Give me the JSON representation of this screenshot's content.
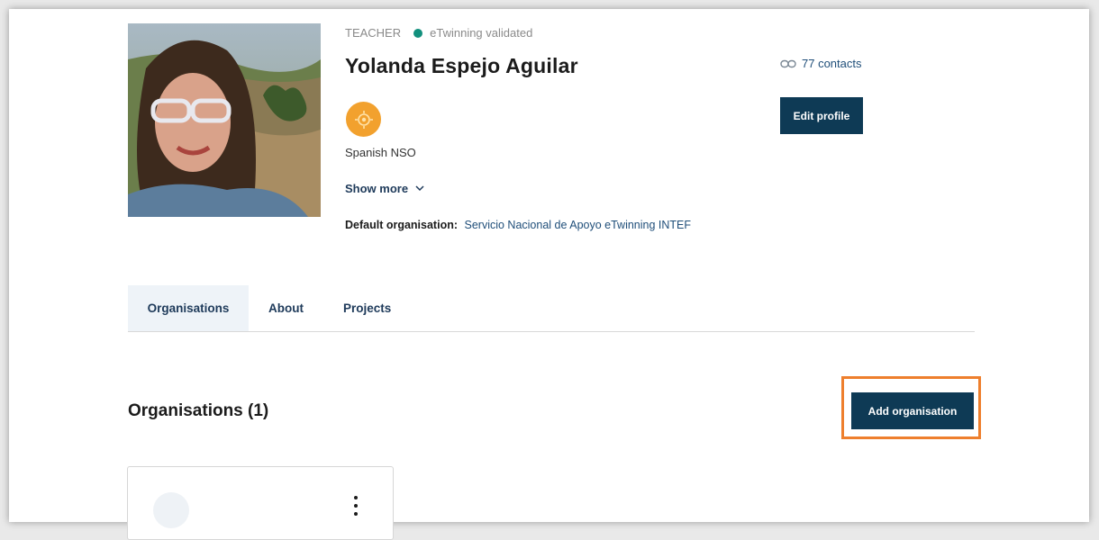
{
  "profile": {
    "role": "TEACHER",
    "validation": "eTwinning validated",
    "name": "Yolanda Espejo Aguilar",
    "affiliation": "Spanish NSO",
    "show_more": "Show more",
    "default_org_label": "Default organisation:",
    "default_org_value": "Servicio Nacional de Apoyo eTwinning INTEF",
    "contacts": "77 contacts",
    "edit_profile": "Edit profile"
  },
  "tabs": [
    {
      "label": "Organisations",
      "active": true
    },
    {
      "label": "About",
      "active": false
    },
    {
      "label": "Projects",
      "active": false
    }
  ],
  "organisations": {
    "title": "Organisations (1)",
    "add_label": "Add organisation"
  },
  "colors": {
    "primary_button": "#0e3a55",
    "validated_dot": "#12907d",
    "highlight": "#ee7f2d",
    "badge": "#f2a12e"
  }
}
